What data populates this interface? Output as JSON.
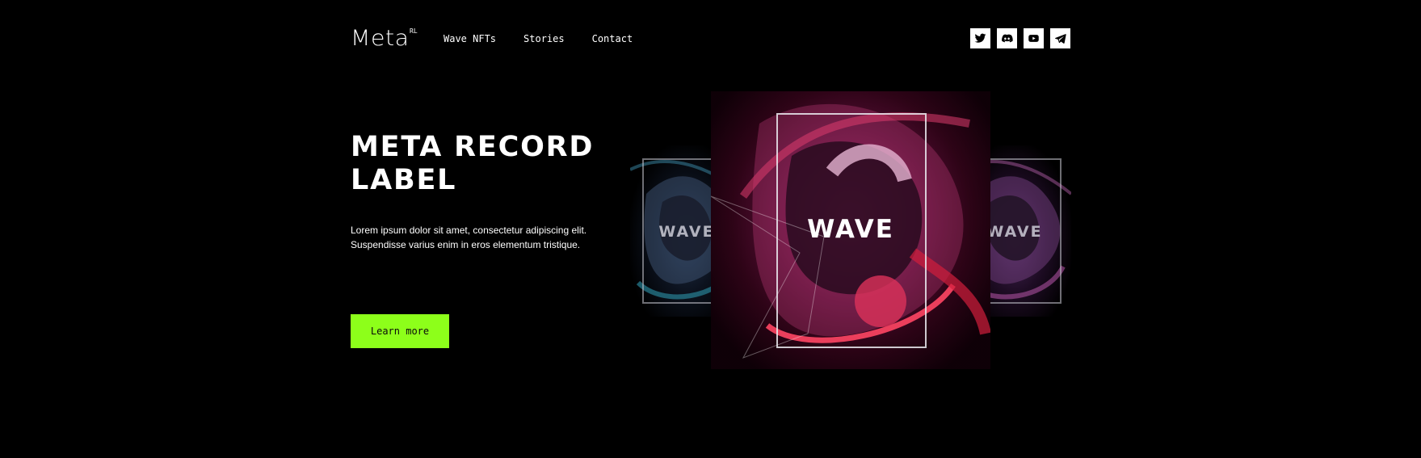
{
  "logo": {
    "word": "Meta",
    "sup": "RL"
  },
  "nav": [
    {
      "label": "Wave NFTs"
    },
    {
      "label": "Stories"
    },
    {
      "label": "Contact"
    }
  ],
  "social": [
    {
      "icon": "twitter-icon"
    },
    {
      "icon": "discord-icon"
    },
    {
      "icon": "youtube-icon"
    },
    {
      "icon": "telegram-icon"
    }
  ],
  "hero": {
    "title_line1": "META RECORD",
    "title_line2": "LABEL",
    "text_line1": "Lorem ipsum dolor sit amet, consectetur adipiscing elit.",
    "text_line2": "Suspendisse varius enim in eros elementum tristique.",
    "cta": "Learn more"
  },
  "artwork": {
    "left": "WAVE",
    "center": "WAVE",
    "right": "WAVE"
  },
  "colors": {
    "background": "#000000",
    "accent": "#8dff1a",
    "text": "#ffffff"
  }
}
